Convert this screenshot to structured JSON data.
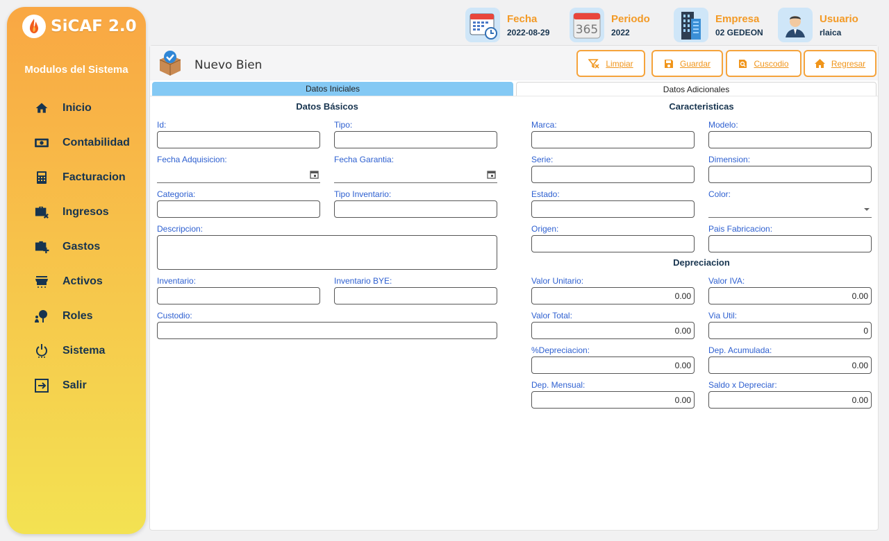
{
  "app": {
    "title": "SiCAF 2.0"
  },
  "sidebar": {
    "title": "Modulos del Sistema",
    "items": [
      {
        "label": "Inicio",
        "icon": "home-icon"
      },
      {
        "label": "Contabilidad",
        "icon": "money-icon"
      },
      {
        "label": "Facturacion",
        "icon": "calculator-icon"
      },
      {
        "label": "Ingresos",
        "icon": "briefcase-remove-icon"
      },
      {
        "label": "Gastos",
        "icon": "briefcase-add-icon"
      },
      {
        "label": "Activos",
        "icon": "store-icon"
      },
      {
        "label": "Roles",
        "icon": "user-tree-icon"
      },
      {
        "label": "Sistema",
        "icon": "power-icon"
      },
      {
        "label": "Salir",
        "icon": "logout-icon"
      }
    ]
  },
  "header": {
    "fecha": {
      "label": "Fecha",
      "value": "2022-08-29"
    },
    "periodo": {
      "label": "Periodo",
      "value": "2022",
      "icon_text": "365"
    },
    "empresa": {
      "label": "Empresa",
      "value": "02 GEDEON"
    },
    "usuario": {
      "label": "Usuario",
      "value": "rlaica"
    }
  },
  "form": {
    "title": "Nuevo Bien",
    "buttons": {
      "limpiar": "Limpiar",
      "guardar": "Guardar",
      "custodio": "Cuscodio",
      "regresar": "Regresar"
    },
    "tabs": {
      "active": "Datos Iniciales",
      "inactive": "Datos Adicionales"
    },
    "sections": {
      "basicos": "Datos Básicos",
      "caracteristicas": "Caracteristicas",
      "depreciacion": "Depreciacion"
    },
    "labels": {
      "id": "Id:",
      "tipo": "Tipo:",
      "fecha_adquisicion": "Fecha Adquisicion:",
      "fecha_garantia": "Fecha Garantia:",
      "categoria": "Categoria:",
      "tipo_inventario": "Tipo Inventario:",
      "descripcion": "Descripcion:",
      "inventario": "Inventario:",
      "inventario_bye": "Inventario BYE:",
      "custodio": "Custodio:",
      "marca": "Marca:",
      "modelo": "Modelo:",
      "serie": "Serie:",
      "dimension": "Dimension:",
      "estado": "Estado:",
      "color": "Color:",
      "origen": "Origen:",
      "pais_fabricacion": "Pais Fabricacion:",
      "valor_unitario": "Valor Unitario:",
      "valor_iva": "Valor IVA:",
      "valor_total": "Valor Total:",
      "via_util": "Via Util:",
      "pct_depreciacion": "%Depreciacion:",
      "dep_acumulada": "Dep. Acumulada:",
      "dep_mensual": "Dep. Mensual:",
      "saldo_depreciar": "Saldo x Depreciar:"
    },
    "values": {
      "valor_unitario": "0.00",
      "valor_iva": "0.00",
      "valor_total": "0.00",
      "via_util": "0",
      "pct_depreciacion": "0.00",
      "dep_acumulada": "0.00",
      "dep_mensual": "0.00",
      "saldo_depreciar": "0.00"
    }
  },
  "colors": {
    "accent": "#f39a26",
    "tab_active": "#84c9f4",
    "label_blue": "#2d5fd0",
    "navy": "#17344f"
  }
}
